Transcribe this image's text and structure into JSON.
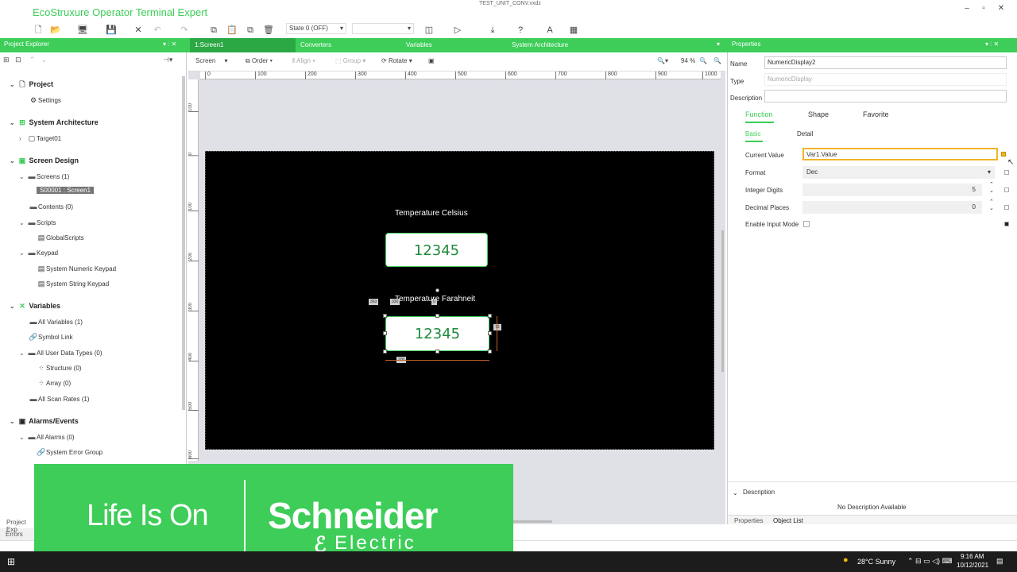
{
  "app": {
    "title": "EcoStruxure Operator Terminal Expert",
    "file_name": "TEST_UNIT_CONV.vxdz",
    "window_controls": [
      "–",
      "▫",
      "✕"
    ]
  },
  "toolbar": {
    "state_select": "State 0 (OFF)",
    "second_select": ""
  },
  "panes": {
    "project_explorer_title": "Project Explorer",
    "properties_title": "Properties",
    "doc_tabs": [
      "1:Screen1",
      "Converters",
      "Variables",
      "System Architecture"
    ]
  },
  "tree": {
    "project": "Project",
    "settings": "Settings",
    "system_architecture": "System Architecture",
    "target01": "Target01",
    "screen_design": "Screen Design",
    "screens": "Screens (1)",
    "screen1": "S00001 : Screen1",
    "contents": "Contents (0)",
    "scripts": "Scripts",
    "global_scripts": "GlobalScripts",
    "keypad": "Keypad",
    "system_numeric_keypad": "System Numeric Keypad",
    "system_string_keypad": "System String Keypad",
    "variables": "Variables",
    "all_variables": "All Variables (1)",
    "symbol_link": "Symbol Link",
    "all_user_data_types": "All User Data Types (0)",
    "structure": "Structure (0)",
    "array": "Array (0)",
    "all_scan_rates": "All Scan Rates (1)",
    "alarms_events": "Alarms/Events",
    "all_alarms": "All Alarms (0)",
    "system_error_group": "System Error Group"
  },
  "editor_toolbar": {
    "screen": "Screen",
    "order": "Order",
    "align": "Align",
    "group": "Group",
    "rotate": "Rotate",
    "zoom": "94 %"
  },
  "ruler": {
    "top": [
      "0",
      "100",
      "200",
      "300",
      "400",
      "500",
      "600",
      "700",
      "800",
      "900",
      "1000"
    ],
    "left": [
      "100",
      "0",
      "100",
      "200",
      "300",
      "400",
      "500",
      "600"
    ]
  },
  "canvas": {
    "label1": "Temperature Celsius",
    "value1": "12345",
    "label2": "Temperature Farahneit",
    "value2": "12345",
    "dim_tags": [
      "363",
      "330",
      "0",
      "73",
      "200"
    ]
  },
  "properties": {
    "name_label": "Name",
    "name_value": "NumericDisplay2",
    "type_label": "Type",
    "type_value": "NumericDisplay",
    "description_label": "Description",
    "description_value": "",
    "tabs": [
      "Function",
      "Shape",
      "Favorite"
    ],
    "subtabs": [
      "Basic",
      "Detail"
    ],
    "current_value_label": "Current Value",
    "current_value": "Var1.Value",
    "format_label": "Format",
    "format_value": "Dec",
    "integer_digits_label": "Integer Digits",
    "integer_digits": "5",
    "decimal_places_label": "Decimal Places",
    "decimal_places": "0",
    "enable_input_mode_label": "Enable Input Mode",
    "desc_section_title": "Description",
    "no_description": "No Description Available",
    "bottom_tabs": [
      "Properties",
      "Object List"
    ]
  },
  "left_bottom": {
    "project_explorer_tab": "Project Exp",
    "errors": "Errors"
  },
  "banner": {
    "life_is_on": "Life Is On",
    "brand": "Schneider",
    "electric": "Electric",
    "color": "#3dcd58"
  },
  "taskbar": {
    "weather": "28°C  Sunny",
    "time": "9:16 AM",
    "date": "10/12/2021"
  },
  "colors": {
    "accent": "#3dcd58",
    "canvas": "#000000",
    "display_text": "#1f8a3a"
  }
}
